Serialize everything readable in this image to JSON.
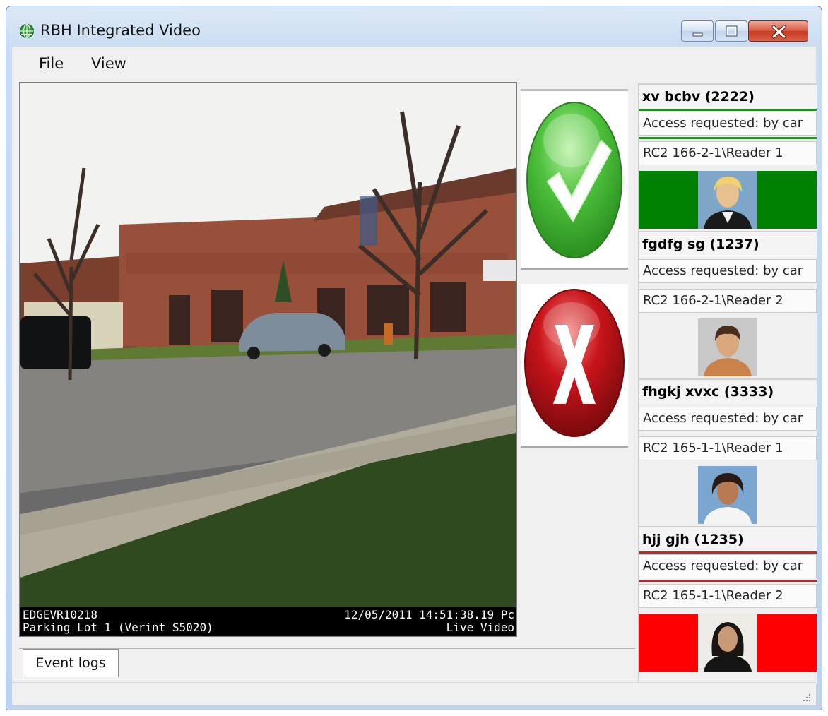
{
  "window": {
    "title": "RBH Integrated Video",
    "controls": [
      "minimize",
      "maximize",
      "close"
    ]
  },
  "menu": [
    {
      "label": "File"
    },
    {
      "label": "View"
    }
  ],
  "video": {
    "device": "EDGEVR10218",
    "camera": "Parking Lot 1 (Verint S5020)",
    "timestamp": "12/05/2011 14:51:38.19 Pc",
    "mode": "Live Video"
  },
  "decision": {
    "accept_icon": "checkmark-icon",
    "reject_icon": "x-icon",
    "accept_color": "#3fb23a",
    "reject_color": "#c8141a"
  },
  "tabs": [
    {
      "label": "Event logs"
    }
  ],
  "events": [
    {
      "name": "xv bcbv (2222)",
      "access": "Access requested: by car",
      "reader": "RC2 166-2-1\\Reader 1",
      "status_color": "#008000",
      "status": "granted"
    },
    {
      "name": "fgdfg sg (1237)",
      "access": "Access requested: by car",
      "reader": "RC2 166-2-1\\Reader 2",
      "status_color": "#f0f0f0",
      "status": "none"
    },
    {
      "name": "fhgkj xvxc (3333)",
      "access": "Access requested: by car",
      "reader": "RC2 165-1-1\\Reader 1",
      "status_color": "#f0f0f0",
      "status": "none"
    },
    {
      "name": "hjj gjh (1235)",
      "access": "Access requested: by car",
      "reader": "RC2 165-1-1\\Reader 2",
      "status_color": "#ff0000",
      "status": "denied"
    }
  ]
}
